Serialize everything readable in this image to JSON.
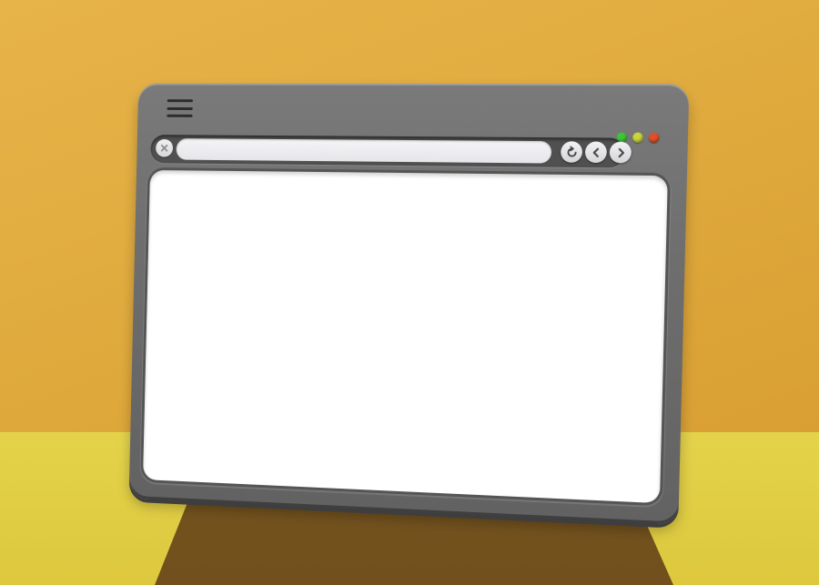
{
  "window": {
    "menu_icon": "hamburger-menu-icon",
    "address_bar": {
      "value": "",
      "placeholder": ""
    },
    "buttons": {
      "stop": "close-x-icon",
      "reload": "reload-icon",
      "back": "chevron-left-icon",
      "forward": "chevron-right-icon"
    },
    "traffic_lights": [
      {
        "name": "green",
        "color": "#3cc43a"
      },
      {
        "name": "yellow",
        "color": "#c8d43a"
      },
      {
        "name": "red",
        "color": "#e0502a"
      }
    ],
    "content_text": ""
  },
  "colors": {
    "wall": "#e0aa3d",
    "floor": "#e1cd45",
    "frame": "#6e6e6e",
    "content": "#ffffff"
  }
}
